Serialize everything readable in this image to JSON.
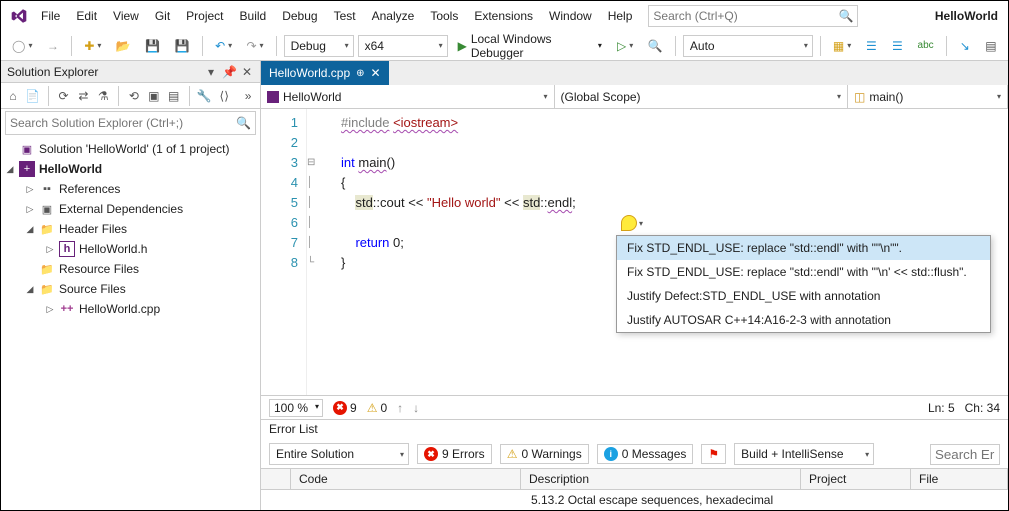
{
  "menu": {
    "items": [
      "File",
      "Edit",
      "View",
      "Git",
      "Project",
      "Build",
      "Debug",
      "Test",
      "Analyze",
      "Tools",
      "Extensions",
      "Window",
      "Help"
    ]
  },
  "search": {
    "placeholder": "Search (Ctrl+Q)"
  },
  "solutionName": "HelloWorld",
  "config": {
    "config": "Debug",
    "platform": "x64",
    "debugger": "Local Windows Debugger",
    "auto": "Auto"
  },
  "explorer": {
    "title": "Solution Explorer",
    "searchPlaceholder": "Search Solution Explorer (Ctrl+;)",
    "root": "Solution 'HelloWorld' (1 of 1 project)",
    "project": "HelloWorld",
    "nodes": {
      "references": "References",
      "externalDeps": "External Dependencies",
      "headerFiles": "Header Files",
      "headerFile": "HelloWorld.h",
      "resourceFiles": "Resource Files",
      "sourceFiles": "Source Files",
      "sourceFile": "HelloWorld.cpp"
    }
  },
  "tab": {
    "name": "HelloWorld.cpp"
  },
  "nav": {
    "project": "HelloWorld",
    "scope": "(Global Scope)",
    "func": "main()"
  },
  "code": {
    "lines": [
      "1",
      "2",
      "3",
      "4",
      "5",
      "6",
      "7",
      "8"
    ]
  },
  "quickfix": {
    "items": [
      "Fix STD_ENDL_USE: replace \"std::endl\" with \"\"\\n\"\".",
      "Fix STD_ENDL_USE: replace \"std::endl\" with \"'\\n' << std::flush\".",
      "Justify Defect:STD_ENDL_USE with annotation",
      "Justify AUTOSAR C++14:A16-2-3 with annotation"
    ]
  },
  "status": {
    "zoom": "100 %",
    "errors": "9",
    "warnings": "0",
    "ln": "Ln: 5",
    "ch": "Ch: 34"
  },
  "errorlist": {
    "title": "Error List",
    "scope": "Entire Solution",
    "errBtn": "9 Errors",
    "warnBtn": "0 Warnings",
    "msgBtn": "0 Messages",
    "filter": "Build + IntelliSense",
    "searchPlaceholder": "Search Err",
    "cols": {
      "code": "Code",
      "desc": "Description",
      "project": "Project",
      "file": "File"
    },
    "firstDesc": "5.13.2 Octal escape sequences, hexadecimal"
  }
}
